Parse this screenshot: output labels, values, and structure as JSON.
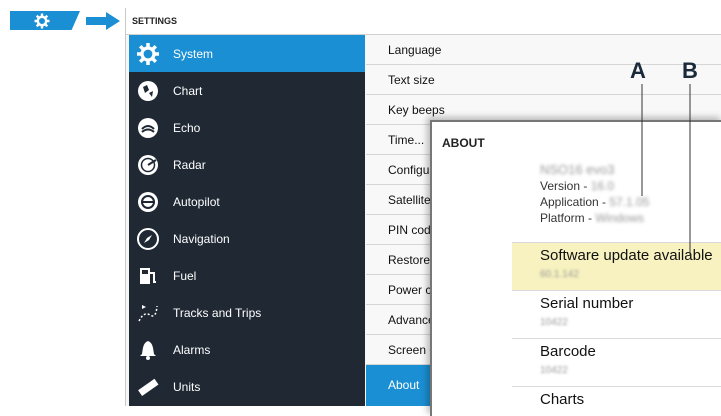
{
  "window": {
    "title": "SETTINGS"
  },
  "sidebar": {
    "items": [
      {
        "label": "System",
        "icon": "gear-icon",
        "selected": true
      },
      {
        "label": "Chart",
        "icon": "chart-icon"
      },
      {
        "label": "Echo",
        "icon": "echo-icon"
      },
      {
        "label": "Radar",
        "icon": "radar-icon"
      },
      {
        "label": "Autopilot",
        "icon": "autopilot-icon"
      },
      {
        "label": "Navigation",
        "icon": "navigation-icon"
      },
      {
        "label": "Fuel",
        "icon": "fuel-icon"
      },
      {
        "label": "Tracks and Trips",
        "icon": "tracks-icon"
      },
      {
        "label": "Alarms",
        "icon": "alarm-bell-icon"
      },
      {
        "label": "Units",
        "icon": "units-icon"
      }
    ]
  },
  "submenu": {
    "items": [
      {
        "label": "Language"
      },
      {
        "label": "Text size"
      },
      {
        "label": "Key beeps"
      },
      {
        "label": "Time..."
      },
      {
        "label": "Configu"
      },
      {
        "label": "Satellite"
      },
      {
        "label": "PIN cod"
      },
      {
        "label": "Restore"
      },
      {
        "label": "Power c"
      },
      {
        "label": "Advance"
      },
      {
        "label": "Screen c"
      },
      {
        "label": "About",
        "selected": true
      }
    ]
  },
  "about": {
    "title": "ABOUT",
    "model": "NSO16 evo3",
    "version_label": "Version - ",
    "version_value": "16.0",
    "application_label": "Application - ",
    "application_value": "57.1.05",
    "platform_label": "Platform - ",
    "platform_value": "Windows",
    "software_update": {
      "label": "Software update available",
      "value": "60.1.142"
    },
    "serial": {
      "label": "Serial number",
      "value": "10422"
    },
    "barcode": {
      "label": "Barcode",
      "value": "10422"
    },
    "charts": {
      "label": "Charts"
    }
  },
  "callouts": {
    "a": "A",
    "b": "B"
  },
  "colors": {
    "accent": "#1b8fd3",
    "sidebar_bg": "#1f2833",
    "highlight": "#f7f2bf"
  }
}
